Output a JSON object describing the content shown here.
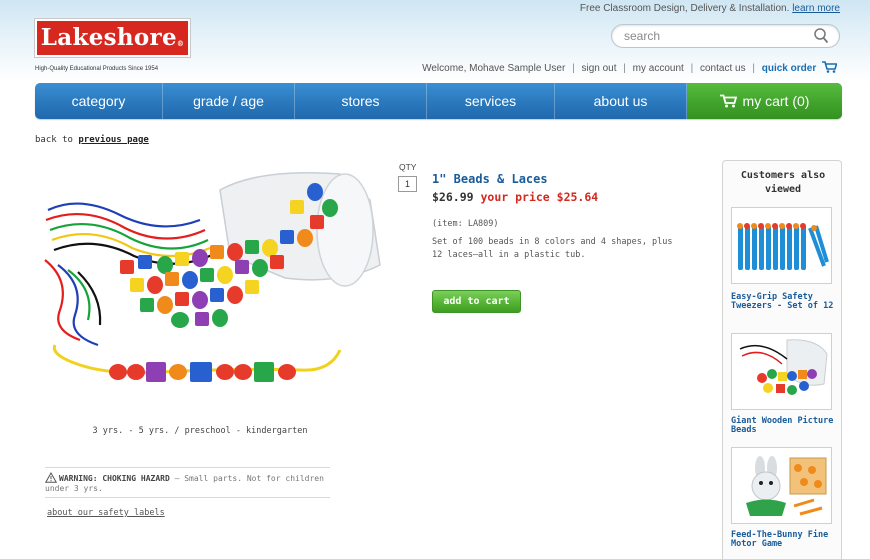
{
  "header": {
    "promo_text": "Free Classroom Design, Delivery & Installation.",
    "promo_link": "learn more",
    "logo_text": "Lakeshore",
    "logo_mark": "®",
    "tagline": "High-Quality Educational Products Since 1954",
    "search_placeholder": "search",
    "welcome": "Welcome, Mohave Sample User",
    "links": {
      "sign_out": "sign out",
      "my_account": "my account",
      "contact_us": "contact us",
      "quick_order": "quick order"
    }
  },
  "nav": {
    "items": [
      "category",
      "grade / age",
      "stores",
      "services",
      "about us"
    ],
    "cart_label": "my cart (0)"
  },
  "breadcrumb": {
    "prefix": "back to",
    "link": "previous page"
  },
  "product": {
    "qty_label": "QTY",
    "qty_value": "1",
    "title": "1\" Beads & Laces",
    "price": "$26.99",
    "your_price": "your price $25.64",
    "item": "(item: LA809)",
    "description": "Set of 100 beads in 8 colors and 4 shapes, plus 12 laces—all in a plastic tub.",
    "add_to_cart": "add to cart",
    "age_range": "3 yrs. - 5 yrs. / preschool - kindergarten",
    "warning_title": "WARNING: CHOKING HAZARD",
    "warning_text": " – Small parts. Not for children under 3 yrs.",
    "safety_link": "about our safety labels"
  },
  "sidebar": {
    "title": "Customers also viewed",
    "items": [
      {
        "name": "Easy-Grip Safety Tweezers - Set of 12"
      },
      {
        "name": "Giant Wooden Picture Beads"
      },
      {
        "name": "Feed-The-Bunny Fine Motor Game"
      }
    ]
  },
  "colors": {
    "nav_blue": "#2a78bd",
    "cart_green": "#3fa12b",
    "logo_red": "#d6281f",
    "link_blue": "#1a5c9a",
    "price_red": "#d22a1e"
  }
}
